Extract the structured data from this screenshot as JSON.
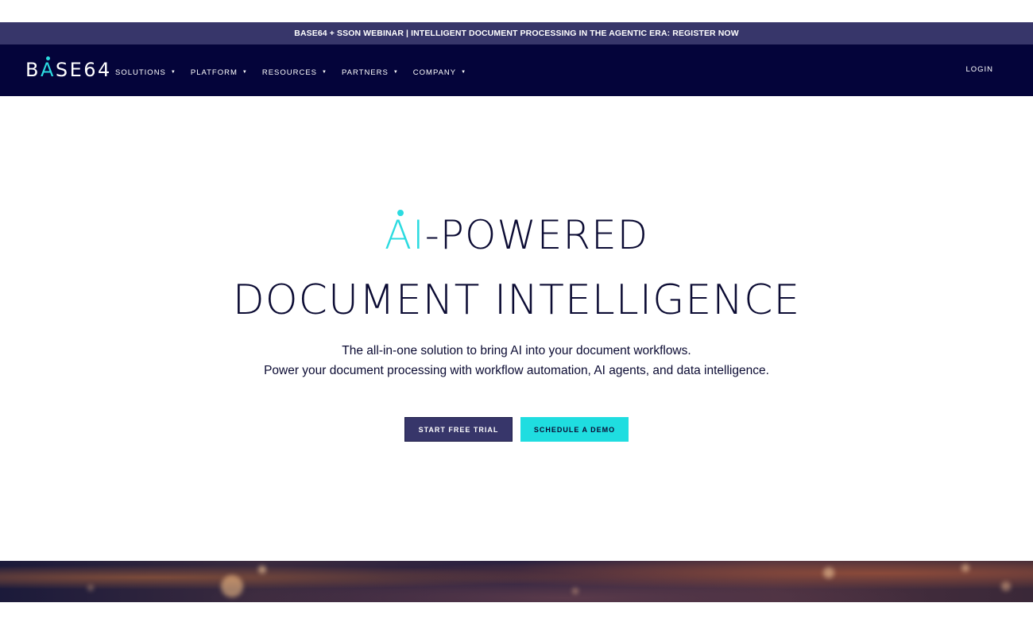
{
  "announcement": {
    "text": "BASE64 + SSON WEBINAR | INTELLIGENT DOCUMENT PROCESSING IN THE AGENTIC ERA: REGISTER NOW"
  },
  "nav": {
    "logo": {
      "pre": "B",
      "accent": "A",
      "post": "SE64"
    },
    "items": [
      {
        "label": "SOLUTIONS"
      },
      {
        "label": "PLATFORM"
      },
      {
        "label": "RESOURCES"
      },
      {
        "label": "PARTNERS"
      },
      {
        "label": "COMPANY"
      }
    ],
    "caret": "▼",
    "login": "LOGIN"
  },
  "hero": {
    "headline_accent": "AI",
    "headline_rest": "-POWERED",
    "headline_line2": "DOCUMENT INTELLIGENCE",
    "sub_line1": "The all-in-one solution to bring AI into your document workflows.",
    "sub_line2": "Power your document processing with workflow automation, AI agents, and data intelligence.",
    "cta_primary": "START FREE TRIAL",
    "cta_secondary": "SCHEDULE A DEMO"
  },
  "colors": {
    "announce_bg": "#37366a",
    "nav_bg": "#04043a",
    "accent": "#2bdbe0",
    "text_dark": "#0b0b33",
    "button_primary": "#37366a",
    "button_secondary": "#1fdde0"
  }
}
